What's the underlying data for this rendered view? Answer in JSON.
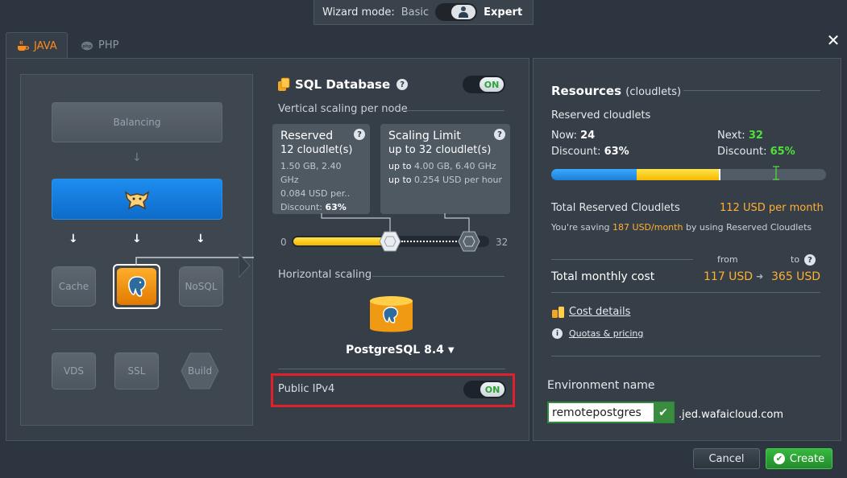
{
  "wizard": {
    "label": "Wizard mode:",
    "basic": "Basic",
    "expert": "Expert"
  },
  "tabs": [
    {
      "label": "JAVA",
      "active": true
    },
    {
      "label": "PHP",
      "active": false
    }
  ],
  "topology": {
    "balancing": "Balancing",
    "cache": "Cache",
    "nosql": "NoSQL",
    "vds": "VDS",
    "ssl": "SSL",
    "build": "Build"
  },
  "database": {
    "title": "SQL Database",
    "toggle": "ON",
    "vertical_label": "Vertical scaling per node",
    "reserved": {
      "title": "Reserved",
      "value": "12 cloudlet(s)",
      "spec": "1.50 GB, 2.40 GHz",
      "price": "0.084 USD per..",
      "discount_label": "Discount:",
      "discount": "63%"
    },
    "limit": {
      "title": "Scaling Limit",
      "value": "up to 32 cloudlet(s)",
      "spec_prefix": "up to",
      "spec": "4.00 GB, 6.40 GHz",
      "price_prefix": "up to",
      "price": "0.254",
      "price_suffix": "USD per hour"
    },
    "slider": {
      "min": "0",
      "max": "32",
      "reserved": 12,
      "limit": 32
    },
    "horizontal_label": "Horizontal scaling",
    "engine": "PostgreSQL 8.4",
    "public_ipv4_label": "Public IPv4",
    "public_ipv4_toggle": "ON"
  },
  "resources": {
    "title": "Resources",
    "title_suffix": "(cloudlets)",
    "reserved_label": "Reserved cloudlets",
    "now_label": "Now:",
    "now": "24",
    "next_label": "Next:",
    "next": "32",
    "discount_label": "Discount:",
    "discount_now": "63%",
    "discount_next": "65%",
    "bar": {
      "now_fraction": 0.31,
      "reserved_fraction": 0.61,
      "next_fraction": 0.82
    },
    "total_reserved_label": "Total Reserved Cloudlets",
    "total_reserved_value": "112 USD per month",
    "saving_prefix": "You're saving",
    "saving_value": "187 USD/month",
    "saving_suffix": "by using Reserved Cloudlets",
    "from_label": "from",
    "to_label": "to",
    "total_monthly_label": "Total monthly cost",
    "cost_from": "117 USD",
    "cost_to": "365 USD",
    "cost_details": "Cost details",
    "quotas": "Quotas & pricing"
  },
  "environment": {
    "label": "Environment name",
    "value": "remotepostgres",
    "domain": ".jed.wafaicloud.com"
  },
  "buttons": {
    "cancel": "Cancel",
    "create": "Create"
  }
}
